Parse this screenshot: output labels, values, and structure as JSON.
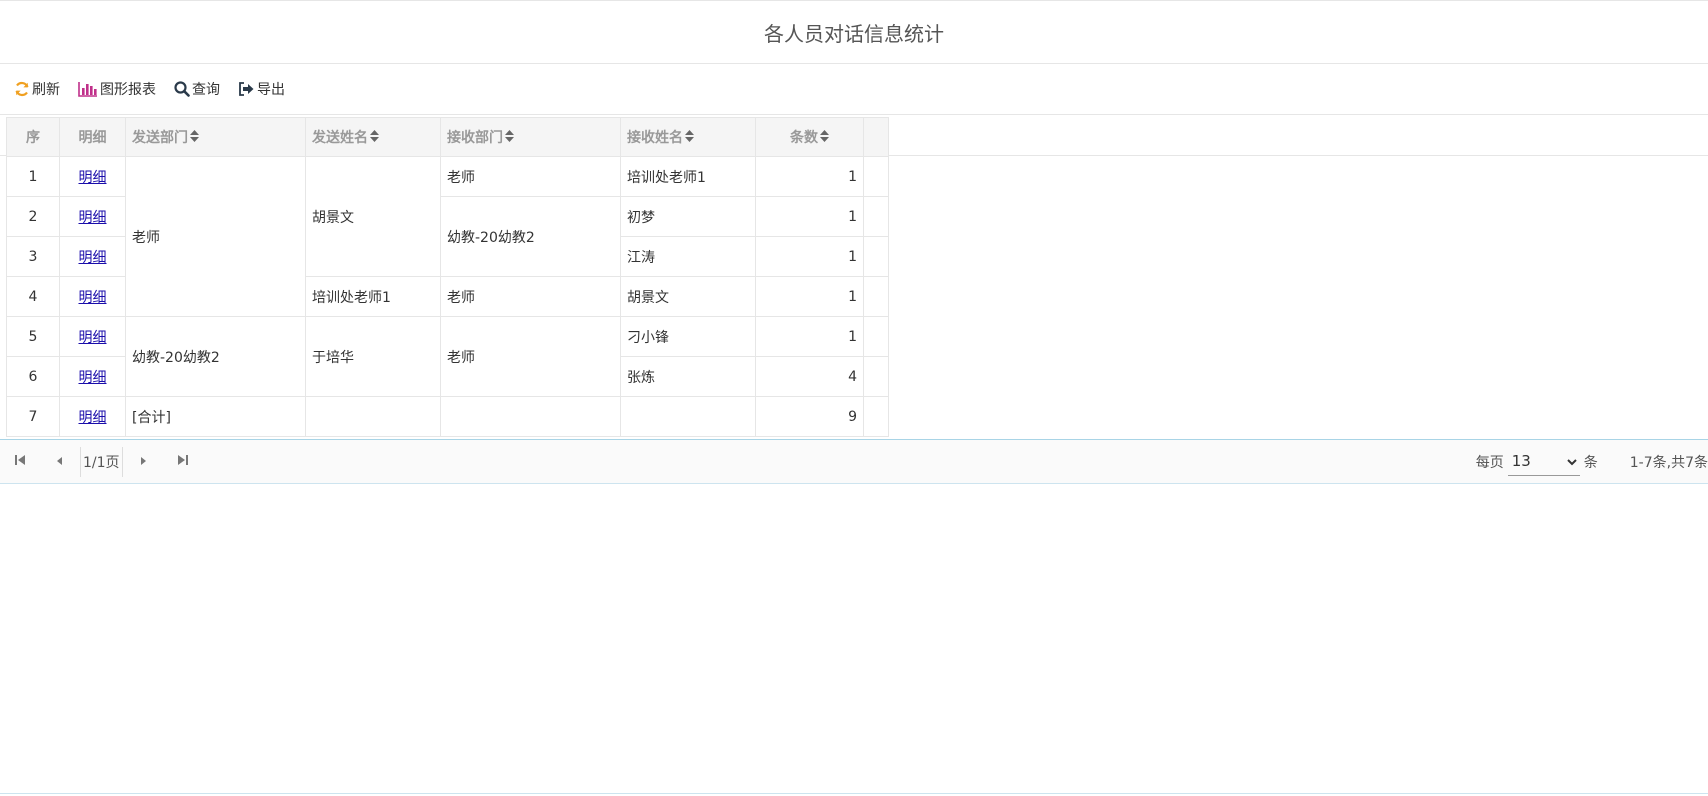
{
  "page": {
    "title": "各人员对话信息统计"
  },
  "toolbar": {
    "refresh_label": "刷新",
    "chart_label": "图形报表",
    "query_label": "查询",
    "export_label": "导出"
  },
  "table": {
    "headers": {
      "seq": "序",
      "detail": "明细",
      "send_dept": "发送部门",
      "send_name": "发送姓名",
      "recv_dept": "接收部门",
      "recv_name": "接收姓名",
      "count": "条数"
    },
    "detail_link": "明细",
    "send_dept": [
      "老师",
      "幼教-20幼教2",
      "[合计]"
    ],
    "send_name": [
      "胡景文",
      "培训处老师1",
      "于培华"
    ],
    "recv_dept": [
      "老师",
      "幼教-20幼教2",
      "老师",
      "老师"
    ],
    "rows": [
      {
        "seq": "1",
        "recv_name": "培训处老师1",
        "count": "1"
      },
      {
        "seq": "2",
        "recv_name": "初梦",
        "count": "1"
      },
      {
        "seq": "3",
        "recv_name": "江涛",
        "count": "1"
      },
      {
        "seq": "4",
        "recv_name": "胡景文",
        "count": "1"
      },
      {
        "seq": "5",
        "recv_name": "刁小锋",
        "count": "1"
      },
      {
        "seq": "6",
        "recv_name": "张炼",
        "count": "4"
      },
      {
        "seq": "7",
        "recv_name": "",
        "count": "9"
      }
    ]
  },
  "pager": {
    "page_info": "1/1页",
    "per_page_label": "每页",
    "per_page_value": "13",
    "unit_label": "条",
    "total_text": "1-7条,共7条"
  },
  "colors": {
    "accent_orange": "#f0a020",
    "chart_magenta": "#c0308a",
    "pager_border": "#a8d4e6"
  }
}
